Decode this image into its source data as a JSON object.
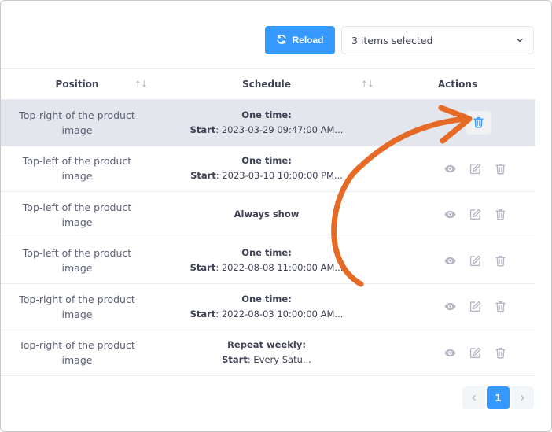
{
  "toolbar": {
    "reload_label": "Reload",
    "select_value": "3 items selected"
  },
  "table": {
    "headers": {
      "position": "Position",
      "schedule": "Schedule",
      "actions": "Actions"
    },
    "rows": [
      {
        "position": "Top-right of the product image",
        "schedule_type": "One time:",
        "start_label": "Start",
        "start_value": ": 2023-03-29 09:47:00 AM...",
        "highlighted": true
      },
      {
        "position": "Top-left of the product image",
        "schedule_type": "One time:",
        "start_label": "Start",
        "start_value": ": 2023-03-10 10:00:00 PM...",
        "highlighted": false
      },
      {
        "position": "Top-left of the product image",
        "schedule_type": "Always show",
        "start_label": "",
        "start_value": "",
        "highlighted": false
      },
      {
        "position": "Top-left of the product image",
        "schedule_type": "One time:",
        "start_label": "Start",
        "start_value": ": 2022-08-08 11:00:00 AM...",
        "highlighted": false
      },
      {
        "position": "Top-right of the product image",
        "schedule_type": "One time:",
        "start_label": "Start",
        "start_value": ": 2022-08-03 10:00:00 AM...",
        "highlighted": false
      },
      {
        "position": "Top-right of the product image",
        "schedule_type": "Repeat weekly:",
        "start_label": "Start",
        "start_value": ": Every Satu...",
        "highlighted": false
      }
    ]
  },
  "pagination": {
    "current_page": "1"
  },
  "colors": {
    "primary": "#3699ff",
    "annotation_arrow": "#e46a25",
    "delete_active": "#3699ff",
    "icon_muted": "#b5b5c3",
    "row_highlight": "#e3e6ed"
  },
  "icons": {
    "reload": "refresh-icon",
    "dropdown": "chevron-down-icon",
    "view": "eye-icon",
    "edit": "edit-icon",
    "delete": "trash-icon",
    "prev": "chevron-left-icon",
    "next": "chevron-right-icon"
  }
}
